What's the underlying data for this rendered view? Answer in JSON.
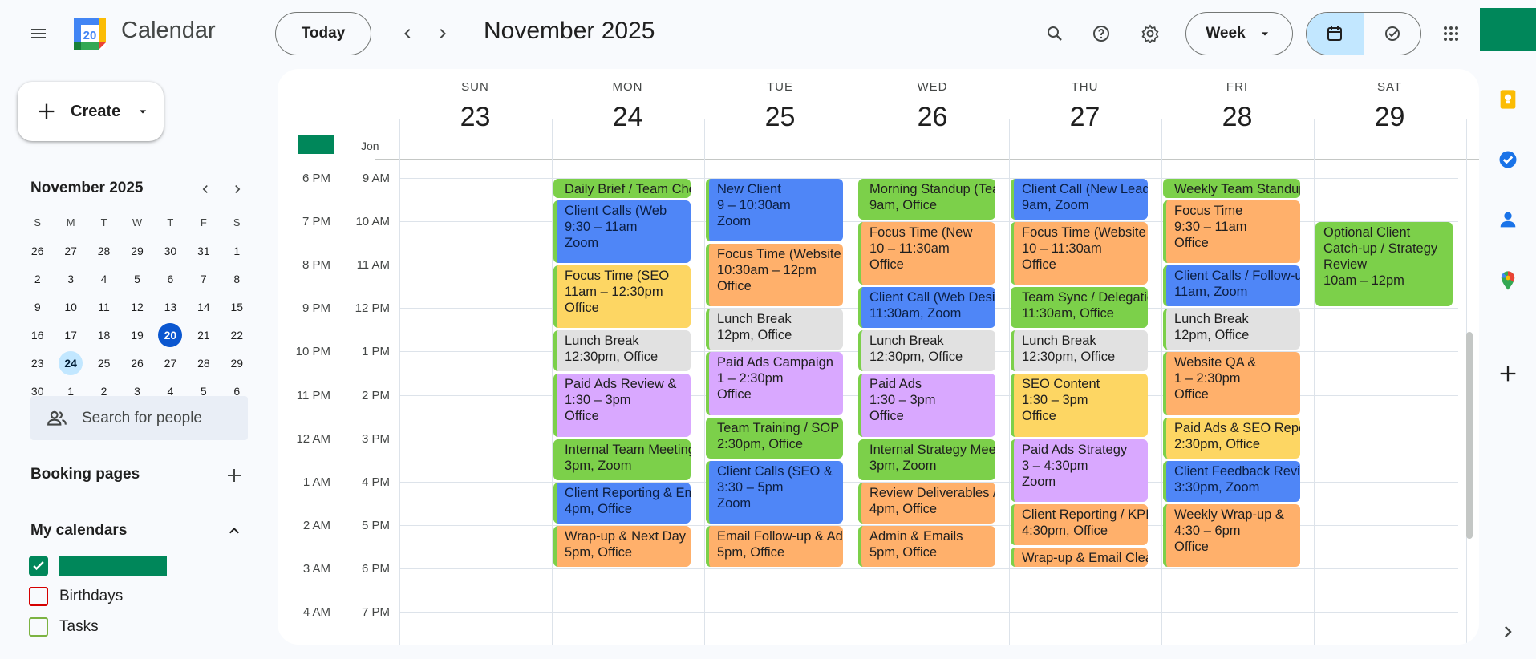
{
  "header": {
    "app_title": "Calendar",
    "logo_day": "20",
    "today_label": "Today",
    "month_title": "November 2025",
    "view_label": "Week"
  },
  "sidebar": {
    "create_label": "Create",
    "mini_month": "November 2025",
    "dows": [
      "S",
      "M",
      "T",
      "W",
      "T",
      "F",
      "S"
    ],
    "weeks": [
      [
        "26",
        "27",
        "28",
        "29",
        "30",
        "31",
        "1"
      ],
      [
        "2",
        "3",
        "4",
        "5",
        "6",
        "7",
        "8"
      ],
      [
        "9",
        "10",
        "11",
        "12",
        "13",
        "14",
        "15"
      ],
      [
        "16",
        "17",
        "18",
        "19",
        "20",
        "21",
        "22"
      ],
      [
        "23",
        "24",
        "25",
        "26",
        "27",
        "28",
        "29"
      ],
      [
        "30",
        "1",
        "2",
        "3",
        "4",
        "5",
        "6"
      ]
    ],
    "today_day": "20",
    "selected_day": "24",
    "search_people": "Search for people",
    "booking_pages": "Booking pages",
    "my_calendars": "My calendars",
    "calendars": [
      {
        "label": "",
        "color": "#00875a",
        "checked": true
      },
      {
        "label": "Birthdays",
        "color": "#d50000",
        "checked": false
      },
      {
        "label": "Tasks",
        "color": "#7cb342",
        "checked": false
      }
    ]
  },
  "week": {
    "tz_label": "Jon",
    "days": [
      {
        "dow": "SUN",
        "num": "23"
      },
      {
        "dow": "MON",
        "num": "24"
      },
      {
        "dow": "TUE",
        "num": "25"
      },
      {
        "dow": "WED",
        "num": "26"
      },
      {
        "dow": "THU",
        "num": "27"
      },
      {
        "dow": "FRI",
        "num": "28"
      },
      {
        "dow": "SAT",
        "num": "29"
      }
    ],
    "times_primary": [
      "6 PM",
      "7 PM",
      "8 PM",
      "9 PM",
      "10 PM",
      "11 PM",
      "12 AM",
      "1 AM",
      "2 AM",
      "3 AM",
      "4 AM"
    ],
    "times_secondary": [
      "9 AM",
      "10 AM",
      "11 AM",
      "12 PM",
      "1 PM",
      "2 PM",
      "3 PM",
      "4 PM",
      "5 PM",
      "6 PM",
      "7 PM"
    ]
  },
  "colors": {
    "green": "#7cd04a",
    "blue": "#4f86f7",
    "orange": "#ffb06b",
    "yellow": "#fdd663",
    "gray": "#e1e1e1",
    "purple": "#d9a8ff"
  },
  "events": [
    {
      "day": 1,
      "start": 9.0,
      "end": 9.5,
      "color": "green",
      "title": "Daily Brief / Team Check-in",
      "detail": ""
    },
    {
      "day": 1,
      "start": 9.5,
      "end": 11.0,
      "color": "blue",
      "title": "Client Calls (Web",
      "detail": "9:30 – 11am",
      "loc": "Zoom"
    },
    {
      "day": 1,
      "start": 11.0,
      "end": 12.5,
      "color": "yellow",
      "title": "Focus Time (SEO",
      "detail": "11am – 12:30pm",
      "loc": "Office"
    },
    {
      "day": 1,
      "start": 12.5,
      "end": 13.5,
      "color": "gray",
      "title": "Lunch Break",
      "detail": "12:30pm, Office"
    },
    {
      "day": 1,
      "start": 13.5,
      "end": 15.0,
      "color": "purple",
      "title": "Paid Ads Review &",
      "detail": "1:30 – 3pm",
      "loc": "Office"
    },
    {
      "day": 1,
      "start": 15.0,
      "end": 16.0,
      "color": "green",
      "title": "Internal Team Meeting",
      "detail": "3pm, Zoom"
    },
    {
      "day": 1,
      "start": 16.0,
      "end": 17.0,
      "color": "blue",
      "title": "Client Reporting & Emails",
      "detail": "4pm, Office"
    },
    {
      "day": 1,
      "start": 17.0,
      "end": 18.0,
      "color": "orange",
      "title": "Wrap-up & Next Day",
      "detail": "5pm, Office"
    },
    {
      "day": 2,
      "start": 9.0,
      "end": 10.5,
      "color": "blue",
      "title": "New Client",
      "detail": "9 – 10:30am",
      "loc": "Zoom"
    },
    {
      "day": 2,
      "start": 10.5,
      "end": 12.0,
      "color": "orange",
      "title": "Focus Time (Website",
      "detail": "10:30am – 12pm",
      "loc": "Office"
    },
    {
      "day": 2,
      "start": 12.0,
      "end": 13.0,
      "color": "gray",
      "title": "Lunch Break",
      "detail": "12pm, Office"
    },
    {
      "day": 2,
      "start": 13.0,
      "end": 14.5,
      "color": "purple",
      "title": "Paid Ads Campaign",
      "detail": "1 – 2:30pm",
      "loc": "Office"
    },
    {
      "day": 2,
      "start": 14.5,
      "end": 15.5,
      "color": "green",
      "title": "Team Training / SOP Review",
      "detail": "2:30pm, Office"
    },
    {
      "day": 2,
      "start": 15.5,
      "end": 17.0,
      "color": "blue",
      "title": "Client Calls (SEO &",
      "detail": "3:30 – 5pm",
      "loc": "Zoom"
    },
    {
      "day": 2,
      "start": 17.0,
      "end": 18.0,
      "color": "orange",
      "title": "Email Follow-up & Admin",
      "detail": "5pm, Office"
    },
    {
      "day": 3,
      "start": 9.0,
      "end": 10.0,
      "color": "green",
      "title": "Morning Standup (Team)",
      "detail": "9am, Office"
    },
    {
      "day": 3,
      "start": 10.0,
      "end": 11.5,
      "color": "orange",
      "title": "Focus Time (New",
      "detail": "10 – 11:30am",
      "loc": "Office"
    },
    {
      "day": 3,
      "start": 11.5,
      "end": 12.5,
      "color": "blue",
      "title": "Client Call (Web Design)",
      "detail": "11:30am, Zoom"
    },
    {
      "day": 3,
      "start": 12.5,
      "end": 13.5,
      "color": "gray",
      "title": "Lunch Break",
      "detail": "12:30pm, Office"
    },
    {
      "day": 3,
      "start": 13.5,
      "end": 15.0,
      "color": "purple",
      "title": "Paid Ads",
      "detail": "1:30 – 3pm",
      "loc": "Office"
    },
    {
      "day": 3,
      "start": 15.0,
      "end": 16.0,
      "color": "green",
      "title": "Internal Strategy Meeting",
      "detail": "3pm, Zoom"
    },
    {
      "day": 3,
      "start": 16.0,
      "end": 17.0,
      "color": "orange",
      "title": "Review Deliverables /",
      "detail": "4pm, Office"
    },
    {
      "day": 3,
      "start": 17.0,
      "end": 18.0,
      "color": "orange",
      "title": "Admin & Emails",
      "detail": "5pm, Office"
    },
    {
      "day": 4,
      "start": 9.0,
      "end": 10.0,
      "color": "blue",
      "title": "Client Call (New Lead)",
      "detail": "9am, Zoom"
    },
    {
      "day": 4,
      "start": 10.0,
      "end": 11.5,
      "color": "orange",
      "title": "Focus Time (Website",
      "detail": "10 – 11:30am",
      "loc": "Office"
    },
    {
      "day": 4,
      "start": 11.5,
      "end": 12.5,
      "color": "green",
      "title": "Team Sync / Delegation",
      "detail": "11:30am, Office"
    },
    {
      "day": 4,
      "start": 12.5,
      "end": 13.5,
      "color": "gray",
      "title": "Lunch Break",
      "detail": "12:30pm, Office"
    },
    {
      "day": 4,
      "start": 13.5,
      "end": 15.0,
      "color": "yellow",
      "title": "SEO Content",
      "detail": "1:30 – 3pm",
      "loc": "Office"
    },
    {
      "day": 4,
      "start": 15.0,
      "end": 16.5,
      "color": "purple",
      "title": "Paid Ads Strategy",
      "detail": "3 – 4:30pm",
      "loc": "Zoom"
    },
    {
      "day": 4,
      "start": 16.5,
      "end": 17.5,
      "color": "orange",
      "title": "Client Reporting / KPIs",
      "detail": "4:30pm, Office"
    },
    {
      "day": 4,
      "start": 17.5,
      "end": 18.0,
      "color": "orange",
      "title": "Wrap-up & Email Cleanup",
      "detail": ""
    },
    {
      "day": 5,
      "start": 9.0,
      "end": 9.5,
      "color": "green",
      "title": "Weekly Team Standup",
      "detail": ""
    },
    {
      "day": 5,
      "start": 9.5,
      "end": 11.0,
      "color": "orange",
      "title": "Focus Time",
      "detail": "9:30 – 11am",
      "loc": "Office"
    },
    {
      "day": 5,
      "start": 11.0,
      "end": 12.0,
      "color": "blue",
      "title": "Client Calls / Follow-ups",
      "detail": "11am, Zoom"
    },
    {
      "day": 5,
      "start": 12.0,
      "end": 13.0,
      "color": "gray",
      "title": "Lunch Break",
      "detail": "12pm, Office"
    },
    {
      "day": 5,
      "start": 13.0,
      "end": 14.5,
      "color": "orange",
      "title": "Website QA &",
      "detail": "1 – 2:30pm",
      "loc": "Office"
    },
    {
      "day": 5,
      "start": 14.5,
      "end": 15.5,
      "color": "yellow",
      "title": "Paid Ads & SEO Report",
      "detail": "2:30pm, Office"
    },
    {
      "day": 5,
      "start": 15.5,
      "end": 16.5,
      "color": "blue",
      "title": "Client Feedback Review",
      "detail": "3:30pm, Zoom"
    },
    {
      "day": 5,
      "start": 16.5,
      "end": 18.0,
      "color": "orange",
      "title": "Weekly Wrap-up &",
      "detail": "4:30 – 6pm",
      "loc": "Office"
    },
    {
      "day": 6,
      "start": 10.0,
      "end": 12.0,
      "color": "green",
      "title": "Optional Client Catch-up / Strategy Review",
      "detail": "10am – 12pm",
      "wrap": true
    }
  ]
}
